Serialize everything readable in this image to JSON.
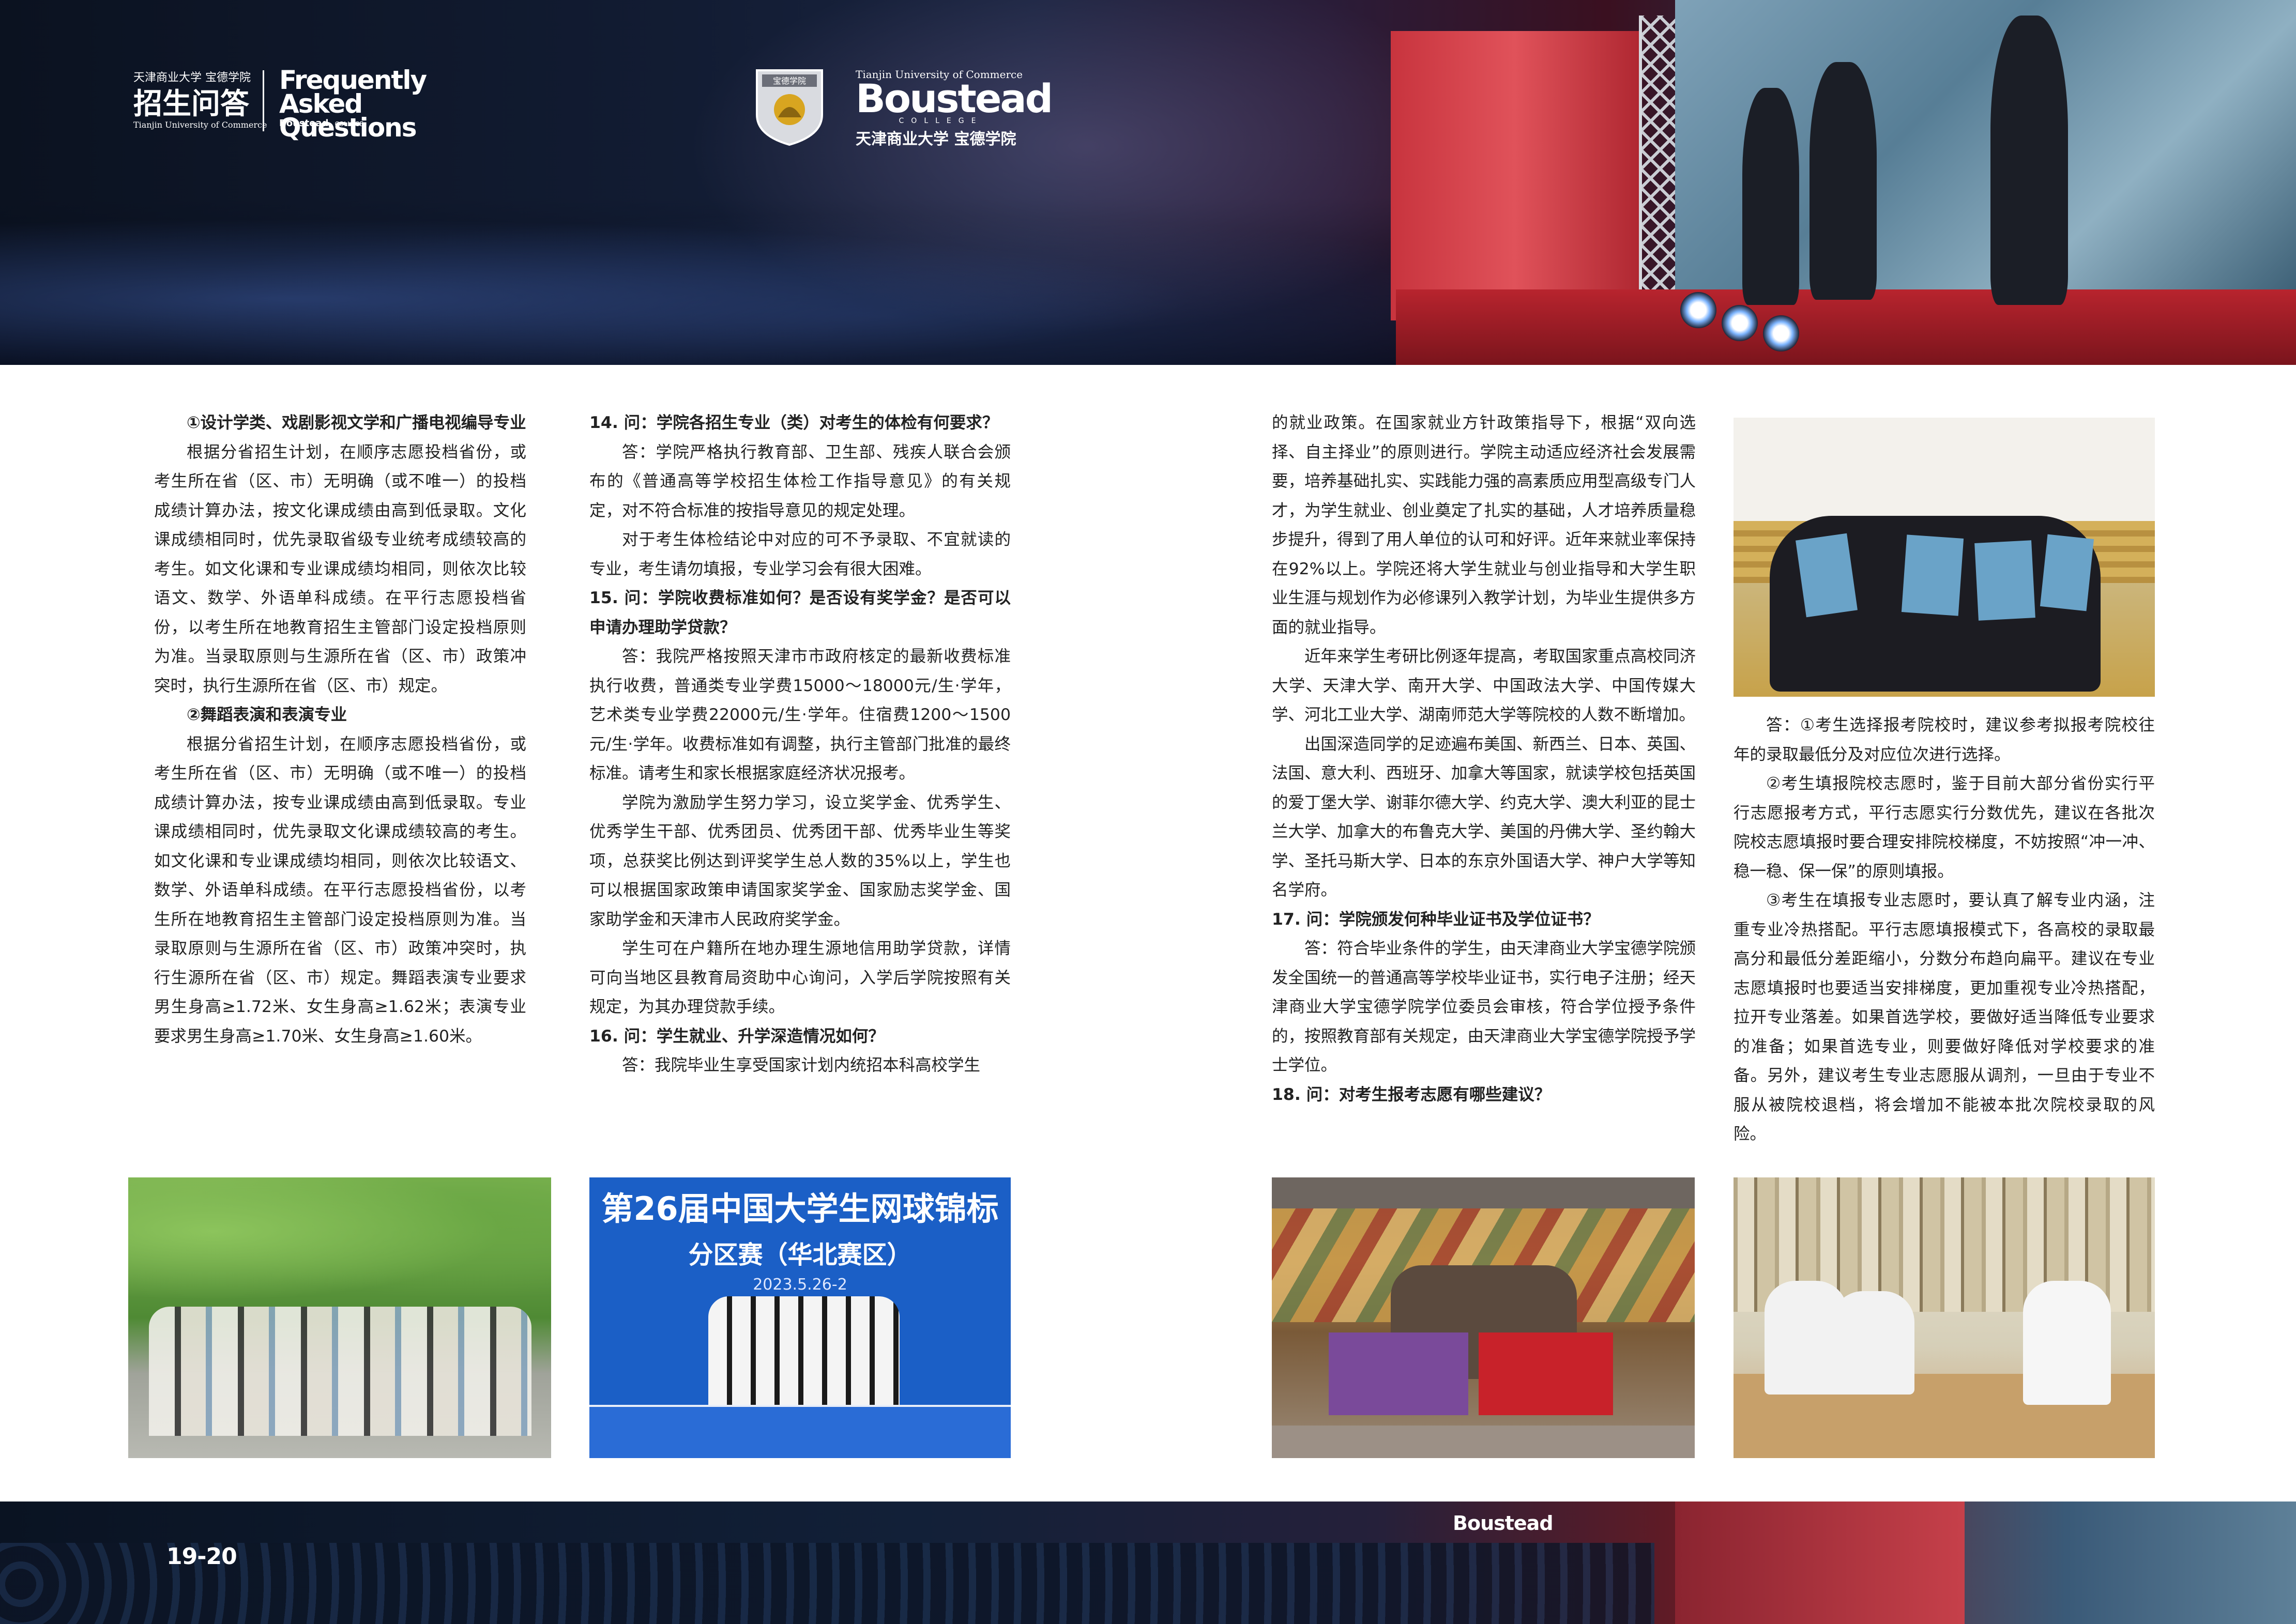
{
  "header": {
    "univ_cn_small": "天津商业大学 宝德学院",
    "title_cn": "招生问答",
    "univ_en_small": "Tianjin University of Commerce",
    "faq_en": "Frequently Asked Questions",
    "faq_sub_brand": "Boustead",
    "faq_sub_college": "COLLEGE",
    "shield_text": "宝德学院",
    "logo_univ_en": "Tianjin University of Commerce",
    "logo_brand": "Boustead",
    "logo_college": "COLLEGE",
    "logo_cn": "天津商业大学 宝德学院"
  },
  "columns": [
    [
      {
        "type": "sub",
        "text": "①设计学类、戏剧影视文学和广播电视编导专业"
      },
      {
        "type": "p",
        "text": "根据分省招生计划，在顺序志愿投档省份，或考生所在省（区、市）无明确（或不唯一）的投档成绩计算办法，按文化课成绩由高到低录取。文化课成绩相同时，优先录取省级专业统考成绩较高的考生。如文化课和专业课成绩均相同，则依次比较语文、数学、外语单科成绩。在平行志愿投档省份，以考生所在地教育招生主管部门设定投档原则为准。当录取原则与生源所在省（区、市）政策冲突时，执行生源所在省（区、市）规定。"
      },
      {
        "type": "sub",
        "text": "②舞蹈表演和表演专业"
      },
      {
        "type": "p",
        "text": "根据分省招生计划，在顺序志愿投档省份，或考生所在省（区、市）无明确（或不唯一）的投档成绩计算办法，按专业课成绩由高到低录取。专业课成绩相同时，优先录取文化课成绩较高的考生。如文化课和专业课成绩均相同，则依次比较语文、数学、外语单科成绩。在平行志愿投档省份，以考生所在地教育招生主管部门设定投档原则为准。当录取原则与生源所在省（区、市）政策冲突时，执行生源所在省（区、市）规定。舞蹈表演专业要求男生身高≥1.72米、女生身高≥1.62米；表演专业要求男生身高≥1.70米、女生身高≥1.60米。"
      }
    ],
    [
      {
        "type": "q",
        "text": "14. 问：学院各招生专业（类）对考生的体检有何要求？"
      },
      {
        "type": "p",
        "text": "答：学院严格执行教育部、卫生部、残疾人联合会颁布的《普通高等学校招生体检工作指导意见》的有关规定，对不符合标准的按指导意见的规定处理。"
      },
      {
        "type": "p",
        "text": "对于考生体检结论中对应的可不予录取、不宜就读的专业，考生请勿填报，专业学习会有很大困难。"
      },
      {
        "type": "q",
        "text": "15. 问：学院收费标准如何？是否设有奖学金？是否可以申请办理助学贷款？"
      },
      {
        "type": "p",
        "text": "答：我院严格按照天津市市政府核定的最新收费标准执行收费，普通类专业学费15000～18000元/生·学年，艺术类专业学费22000元/生·学年。住宿费1200～1500元/生·学年。收费标准如有调整，执行主管部门批准的最终标准。请考生和家长根据家庭经济状况报考。"
      },
      {
        "type": "p",
        "text": "学院为激励学生努力学习，设立奖学金、优秀学生、优秀学生干部、优秀团员、优秀团干部、优秀毕业生等奖项，总获奖比例达到评奖学生总人数的35%以上，学生也可以根据国家政策申请国家奖学金、国家励志奖学金、国家助学金和天津市人民政府奖学金。"
      },
      {
        "type": "p",
        "text": "学生可在户籍所在地办理生源地信用助学贷款，详情可向当地区县教育局资助中心询问，入学后学院按照有关规定，为其办理贷款手续。"
      },
      {
        "type": "q",
        "text": "16. 问：学生就业、升学深造情况如何？"
      },
      {
        "type": "p",
        "text": "答：我院毕业生享受国家计划内统招本科高校学生"
      }
    ],
    [
      {
        "type": "cont",
        "text": "的就业政策。在国家就业方针政策指导下，根据“双向选择、自主择业”的原则进行。学院主动适应经济社会发展需要，培养基础扎实、实践能力强的高素质应用型高级专门人才，为学生就业、创业奠定了扎实的基础，人才培养质量稳步提升，得到了用人单位的认可和好评。近年来就业率保持在92%以上。学院还将大学生就业与创业指导和大学生职业生涯与规划作为必修课列入教学计划，为毕业生提供多方面的就业指导。"
      },
      {
        "type": "p",
        "text": "近年来学生考研比例逐年提高，考取国家重点高校同济大学、天津大学、南开大学、中国政法大学、中国传媒大学、河北工业大学、湖南师范大学等院校的人数不断增加。"
      },
      {
        "type": "p",
        "text": "出国深造同学的足迹遍布美国、新西兰、日本、英国、法国、意大利、西班牙、加拿大等国家，就读学校包括英国的爱丁堡大学、谢菲尔德大学、约克大学、澳大利亚的昆士兰大学、加拿大的布鲁克大学、美国的丹佛大学、圣约翰大学、圣托马斯大学、日本的东京外国语大学、神户大学等知名学府。"
      },
      {
        "type": "q",
        "text": "17. 问：学院颁发何种毕业证书及学位证书？"
      },
      {
        "type": "p",
        "text": "答：符合毕业条件的学生，由天津商业大学宝德学院颁发全国统一的普通高等学校毕业证书，实行电子注册；经天津商业大学宝德学院学位委员会审核，符合学位授予条件的，按照教育部有关规定，由天津商业大学宝德学院授予学士学位。"
      },
      {
        "type": "q",
        "text": "18. 问：对考生报考志愿有哪些建议？"
      }
    ],
    [
      {
        "type": "p",
        "text": "答：①考生选择报考院校时，建议参考拟报考院校往年的录取最低分及对应位次进行选择。"
      },
      {
        "type": "p",
        "text": "②考生填报院校志愿时，鉴于目前大部分省份实行平行志愿报考方式，平行志愿实行分数优先，建议在各批次院校志愿填报时要合理安排院校梯度，不妨按照“冲一冲、稳一稳、保一保”的原则填报。"
      },
      {
        "type": "p",
        "text": "③考生在填报专业志愿时，要认真了解专业内涵，注重专业冷热搭配。平行志愿填报模式下，各高校的录取最高分和最低分差距缩小，分数分布趋向扁平。建议在专业志愿填报时也要适当安排梯度，更加重视专业冷热搭配，拉开专业落差。如果首选学校，要做好适当降低专业要求的准备；如果首选专业，则要做好降低对学校要求的准备。另外，建议考生专业志愿服从调剂，一旦由于专业不服从被院校退档，将会增加不能被本批次院校录取的风险。"
      }
    ]
  ],
  "photos": {
    "tennis_banner_line1": "第26届中国大学生网球锦标",
    "tennis_banner_line2": "分区赛（华北赛区）",
    "tennis_banner_date": "2023.5.26-2",
    "stage_logo": "Boustead"
  },
  "footer": {
    "page_number": "19-20",
    "stage_logo": "Boustead"
  },
  "colors": {
    "banner_dark": "#0b1220",
    "stage_red": "#c8343e",
    "tennis_blue": "#1b5fc6",
    "text": "#222222"
  }
}
